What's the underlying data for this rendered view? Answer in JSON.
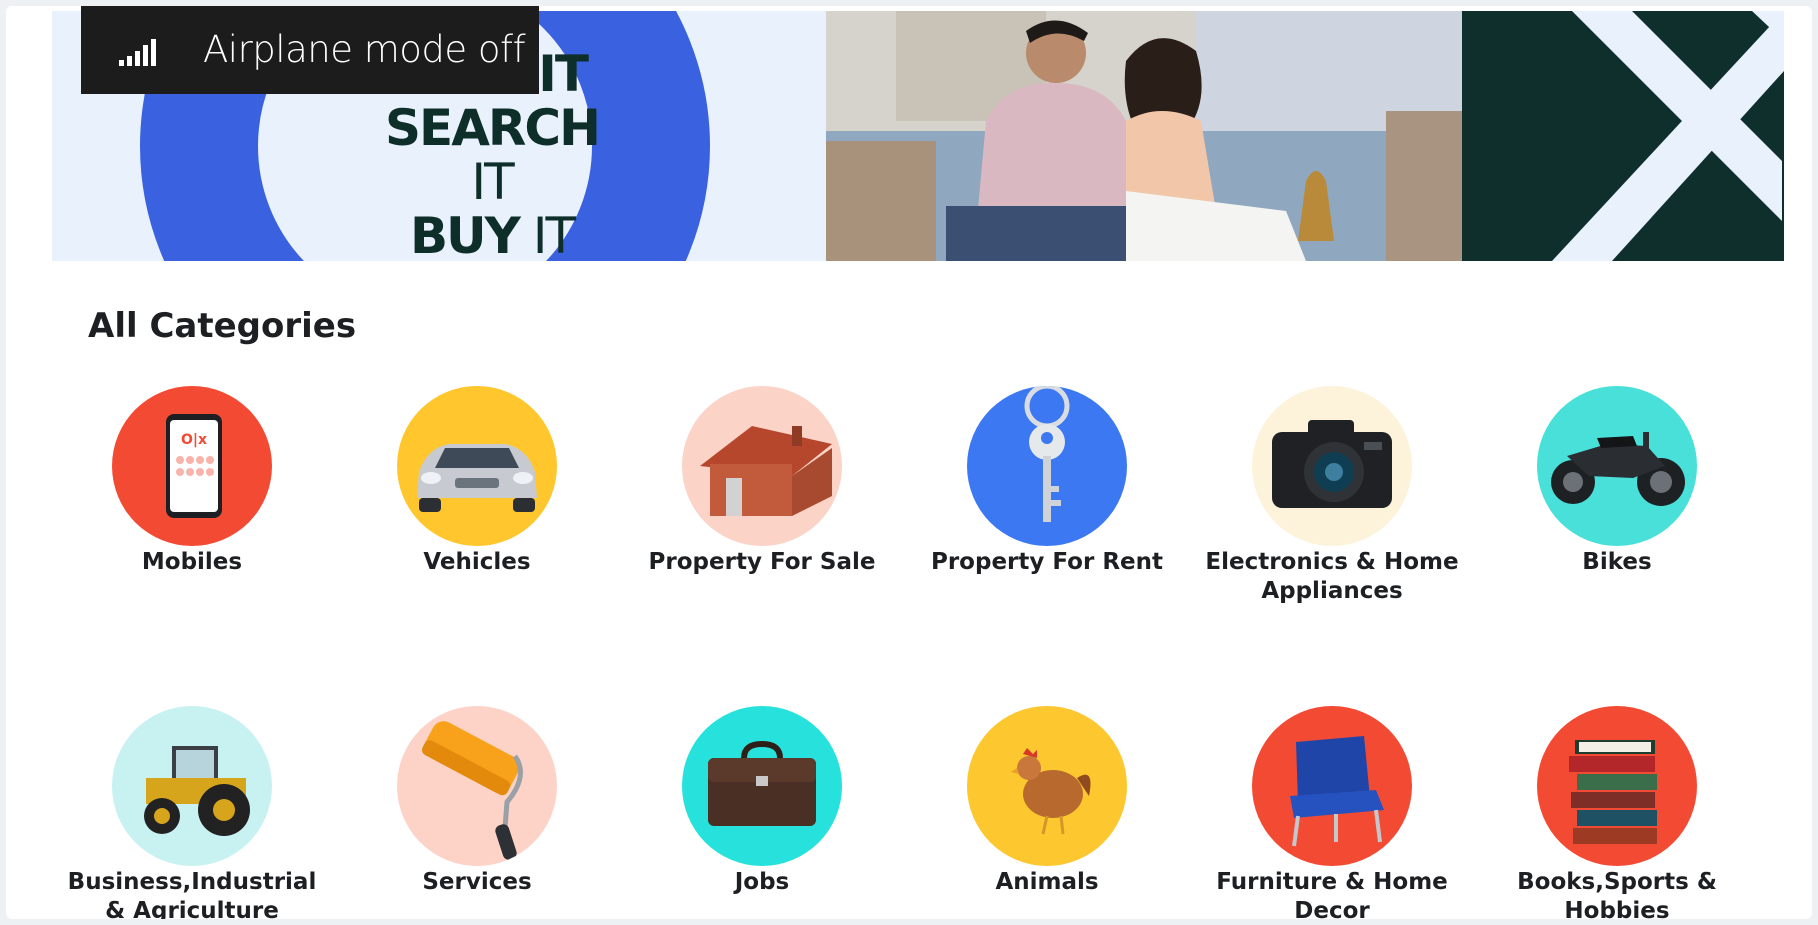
{
  "toast": {
    "label": "Airplane mode off",
    "icon": "signal-bars-icon"
  },
  "banner": {
    "line1": "SELL IT",
    "line2_bold": "SEARCH",
    "line2_thin": " IT",
    "line3_bold": "BUY",
    "line3_thin": " IT"
  },
  "heading": "All Categories",
  "categories": [
    {
      "label": "Mobiles",
      "color": "#f34a34",
      "icon": "mobile-phone-icon"
    },
    {
      "label": "Vehicles",
      "color": "#ffc72d",
      "icon": "car-icon"
    },
    {
      "label": "Property For Sale",
      "color": "#fbd3c7",
      "icon": "house-icon"
    },
    {
      "label": "Property For Rent",
      "color": "#3b78f2",
      "icon": "key-icon"
    },
    {
      "label": "Electronics & Home Appliances",
      "color": "#fdf3da",
      "icon": "camera-icon"
    },
    {
      "label": "Bikes",
      "color": "#49e0d9",
      "icon": "motorbike-icon"
    },
    {
      "label": "Business,Industrial & Agriculture",
      "color": "#c8f1f2",
      "icon": "tractor-icon"
    },
    {
      "label": "Services",
      "color": "#fdd3c8",
      "icon": "paint-roller-icon"
    },
    {
      "label": "Jobs",
      "color": "#26e1dc",
      "icon": "briefcase-icon"
    },
    {
      "label": "Animals",
      "color": "#fcc72f",
      "icon": "hen-icon"
    },
    {
      "label": "Furniture & Home Decor",
      "color": "#f34a34",
      "icon": "armchair-icon"
    },
    {
      "label": "Books,Sports & Hobbies",
      "color": "#f34a34",
      "icon": "books-icon"
    }
  ]
}
